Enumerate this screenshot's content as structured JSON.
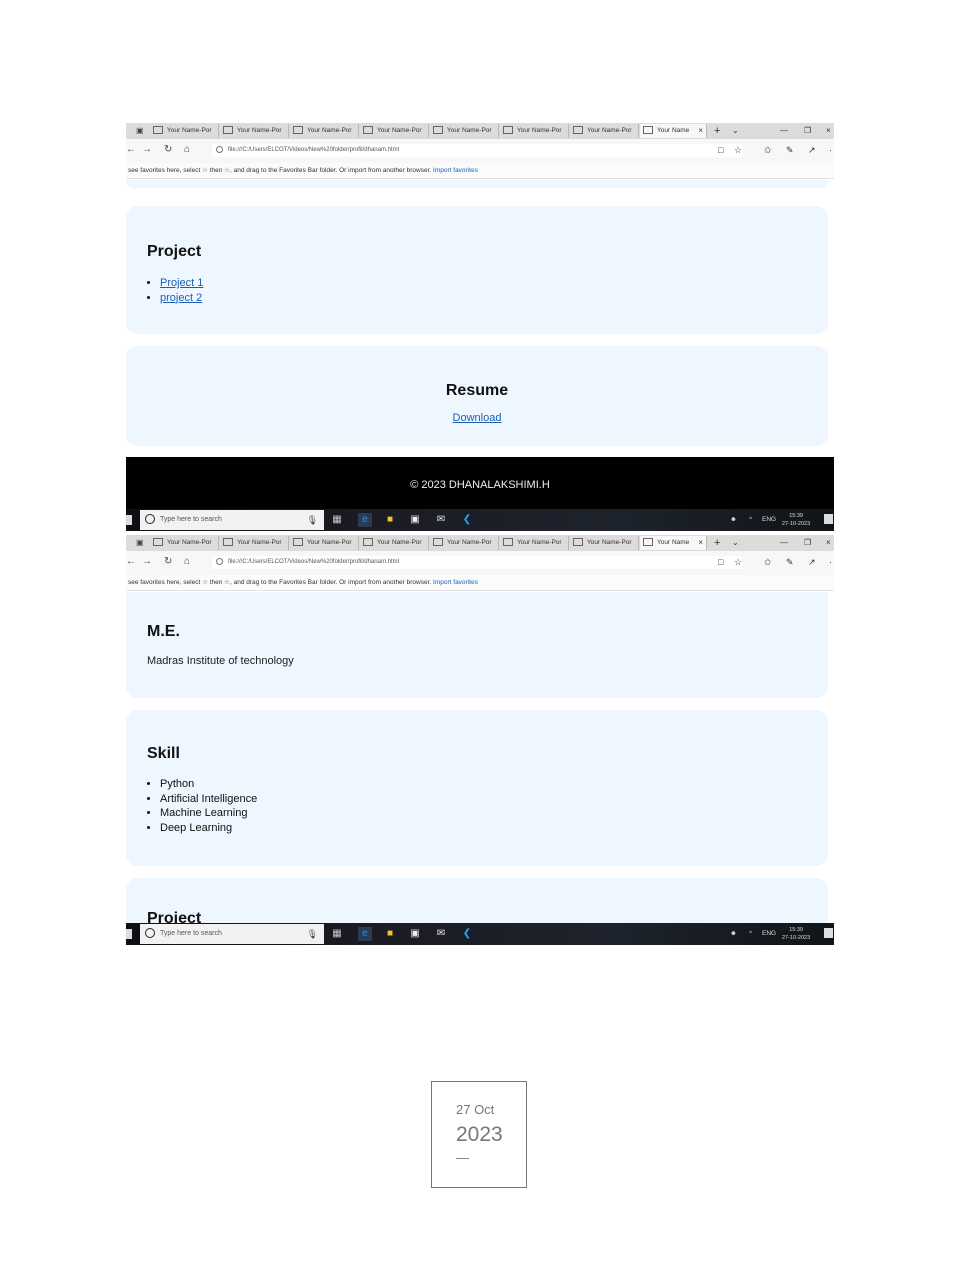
{
  "browser": {
    "tab_title": "Your Name-Por",
    "active_tab_title": "Your Name",
    "url": "file:///C:/Users/ELCOT/Videos/New%20folder/profil/dhanam.html",
    "favorites_hint": "see favorites here, select ☆ then ☆, and drag to the Favorites Bar folder. Or import from another browser.",
    "import_link": "Import favorites"
  },
  "shot1": {
    "project": {
      "heading": "Project",
      "items": [
        "Project 1",
        "project 2"
      ]
    },
    "resume": {
      "heading": "Resume",
      "link": "Download"
    },
    "footer": "© 2023 DHANALAKSHIMI.H"
  },
  "shot2": {
    "education": {
      "heading": "M.E.",
      "institution": "Madras Institute of technology"
    },
    "skill": {
      "heading": "Skill",
      "items": [
        "Python",
        "Artificial Intelligence",
        "Machine Learning",
        "Deep Learning"
      ]
    },
    "project_heading": "Project"
  },
  "taskbar": {
    "search_placeholder": "Type here to search",
    "language": "ENG",
    "time": "15:39",
    "date": "27-10-2023"
  },
  "stamp": {
    "day_month": "27 Oct",
    "year": "2023",
    "dash": "—"
  },
  "colors": {
    "card_bg": "#eef6ff",
    "link": "#1a5fb4",
    "footer_bg": "#000000"
  }
}
